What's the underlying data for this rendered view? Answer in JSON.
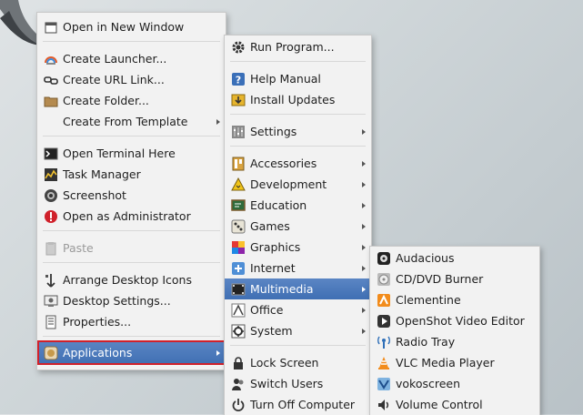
{
  "desktop_menu": {
    "items": [
      {
        "label": "Open in New Window",
        "icon": "window-icon"
      },
      {
        "label": "Create Launcher...",
        "icon": "launcher-icon"
      },
      {
        "label": "Create URL Link...",
        "icon": "link-icon"
      },
      {
        "label": "Create Folder...",
        "icon": "folder-icon"
      },
      {
        "label": "Create From Template",
        "icon": "",
        "submenu": true
      },
      {
        "label": "Open Terminal Here",
        "icon": "terminal-icon"
      },
      {
        "label": "Task Manager",
        "icon": "task-manager-icon"
      },
      {
        "label": "Screenshot",
        "icon": "screenshot-icon"
      },
      {
        "label": "Open as Administrator",
        "icon": "admin-icon"
      },
      {
        "label": "Paste",
        "icon": "paste-icon",
        "disabled": true
      },
      {
        "label": "Arrange Desktop Icons",
        "icon": "arrange-icon"
      },
      {
        "label": "Desktop Settings...",
        "icon": "desktop-settings-icon"
      },
      {
        "label": "Properties...",
        "icon": "properties-icon"
      },
      {
        "label": "Applications",
        "icon": "applications-icon",
        "submenu": true,
        "active": true
      }
    ]
  },
  "applications_menu": {
    "items": [
      {
        "label": "Run Program...",
        "icon": "gear-icon"
      },
      {
        "label": "Help Manual",
        "icon": "help-icon"
      },
      {
        "label": "Install Updates",
        "icon": "updates-icon"
      },
      {
        "label": "Settings",
        "icon": "settings-icon",
        "submenu": true
      },
      {
        "label": "Accessories",
        "icon": "accessories-icon",
        "submenu": true
      },
      {
        "label": "Development",
        "icon": "development-icon",
        "submenu": true
      },
      {
        "label": "Education",
        "icon": "education-icon",
        "submenu": true
      },
      {
        "label": "Games",
        "icon": "games-icon",
        "submenu": true
      },
      {
        "label": "Graphics",
        "icon": "graphics-icon",
        "submenu": true
      },
      {
        "label": "Internet",
        "icon": "internet-icon",
        "submenu": true
      },
      {
        "label": "Multimedia",
        "icon": "multimedia-icon",
        "submenu": true,
        "active": true
      },
      {
        "label": "Office",
        "icon": "office-icon",
        "submenu": true
      },
      {
        "label": "System",
        "icon": "system-icon",
        "submenu": true
      },
      {
        "label": "Lock Screen",
        "icon": "lock-icon"
      },
      {
        "label": "Switch Users",
        "icon": "switch-users-icon"
      },
      {
        "label": "Turn Off Computer",
        "icon": "power-icon"
      }
    ]
  },
  "multimedia_menu": {
    "items": [
      {
        "label": "Audacious",
        "icon": "audacious-icon"
      },
      {
        "label": "CD/DVD Burner",
        "icon": "cd-burner-icon"
      },
      {
        "label": "Clementine",
        "icon": "clementine-icon"
      },
      {
        "label": "OpenShot Video Editor",
        "icon": "openshot-icon"
      },
      {
        "label": "Radio Tray",
        "icon": "radio-tray-icon"
      },
      {
        "label": "VLC Media Player",
        "icon": "vlc-icon"
      },
      {
        "label": "vokoscreen",
        "icon": "vokoscreen-icon"
      },
      {
        "label": "Volume Control",
        "icon": "volume-icon"
      }
    ]
  },
  "colors": {
    "highlight": "#4a78ba",
    "outline": "#d0212b",
    "menu_bg": "#f2f2f2"
  }
}
